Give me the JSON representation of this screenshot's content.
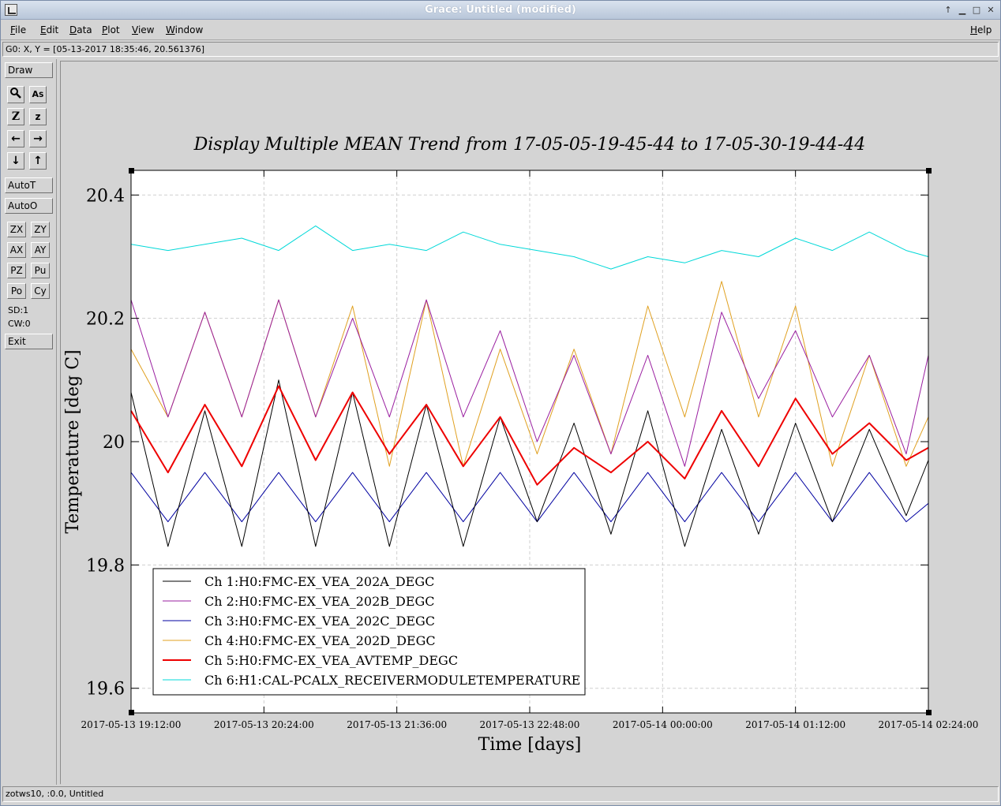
{
  "window": {
    "title": "Grace: Untitled (modified)"
  },
  "menubar": {
    "items": [
      "File",
      "Edit",
      "Data",
      "Plot",
      "View",
      "Window"
    ],
    "help": "Help"
  },
  "coord_readout": "G0: X, Y = [05-13-2017 18:35:46, 20.561376]",
  "toolbar": {
    "draw": "Draw",
    "autot": "AutoT",
    "autoo": "AutoO",
    "zx": "ZX",
    "zy": "ZY",
    "ax": "AX",
    "ay": "AY",
    "pz": "PZ",
    "pu": "Pu",
    "po": "Po",
    "cy": "Cy",
    "sd": "SD:1",
    "cw": "CW:0",
    "exit": "Exit"
  },
  "statusbar": "zotws10, :0.0, Untitled",
  "chart_data": {
    "type": "line",
    "title": "Display Multiple MEAN Trend from 17-05-05-19-45-44 to 17-05-30-19-44-44",
    "xlabel": "Time [days]",
    "ylabel": "Temperature [deg C]",
    "xlim": [
      "2017-05-13 19:12:00",
      "2017-05-14 02:24:00"
    ],
    "ylim": [
      19.56,
      20.44
    ],
    "x_ticks": [
      "2017-05-13 19:12:00",
      "2017-05-13 20:24:00",
      "2017-05-13 21:36:00",
      "2017-05-13 22:48:00",
      "2017-05-14 00:00:00",
      "2017-05-14 01:12:00",
      "2017-05-14 02:24:00"
    ],
    "y_ticks": [
      "19.6",
      "19.8",
      "20",
      "20.2",
      "20.4"
    ],
    "y_tick_values": [
      19.6,
      19.8,
      20.0,
      20.2,
      20.4
    ],
    "grid": true,
    "legend_position": "bottom-left",
    "x_minutes_from_start": [
      0,
      20,
      40,
      60,
      80,
      100,
      120,
      140,
      160,
      180,
      200,
      220,
      240,
      260,
      280,
      300,
      320,
      340,
      360,
      380,
      400,
      420,
      432
    ],
    "series": [
      {
        "name": "Ch 1:H0:FMC-EX_VEA_202A_DEGC",
        "color": "#000000",
        "width": 1,
        "values": [
          20.08,
          19.83,
          20.05,
          19.83,
          20.1,
          19.83,
          20.08,
          19.83,
          20.06,
          19.83,
          20.04,
          19.87,
          20.03,
          19.85,
          20.05,
          19.83,
          20.02,
          19.85,
          20.03,
          19.87,
          20.02,
          19.88,
          19.97
        ]
      },
      {
        "name": "Ch 2:H0:FMC-EX_VEA_202B_DEGC",
        "color": "#9a1fa0",
        "width": 1,
        "values": [
          20.23,
          20.04,
          20.21,
          20.04,
          20.23,
          20.04,
          20.2,
          20.04,
          20.23,
          20.04,
          20.18,
          20.0,
          20.14,
          19.98,
          20.14,
          19.96,
          20.21,
          20.07,
          20.18,
          20.04,
          20.14,
          19.98,
          20.14
        ]
      },
      {
        "name": "Ch 3:H0:FMC-EX_VEA_202C_DEGC",
        "color": "#0000a0",
        "width": 1,
        "values": [
          19.95,
          19.87,
          19.95,
          19.87,
          19.95,
          19.87,
          19.95,
          19.87,
          19.95,
          19.87,
          19.95,
          19.87,
          19.95,
          19.87,
          19.95,
          19.87,
          19.95,
          19.87,
          19.95,
          19.87,
          19.95,
          19.87,
          19.9
        ]
      },
      {
        "name": "Ch 4:H0:FMC-EX_VEA_202D_DEGC",
        "color": "#e0a020",
        "width": 1,
        "values": [
          20.15,
          20.04,
          20.21,
          20.04,
          20.23,
          20.04,
          20.22,
          19.96,
          20.23,
          19.96,
          20.15,
          19.98,
          20.15,
          19.98,
          20.22,
          20.04,
          20.26,
          20.04,
          20.22,
          19.96,
          20.14,
          19.96,
          20.04
        ]
      },
      {
        "name": "Ch 5:H0:FMC-EX_VEA_AVTEMP_DEGC",
        "color": "#ee0000",
        "width": 2,
        "values": [
          20.05,
          19.95,
          20.06,
          19.96,
          20.09,
          19.97,
          20.08,
          19.98,
          20.06,
          19.96,
          20.04,
          19.93,
          19.99,
          19.95,
          20.0,
          19.94,
          20.05,
          19.96,
          20.07,
          19.98,
          20.03,
          19.97,
          19.99
        ]
      },
      {
        "name": "Ch 6:H1:CAL-PCALX_RECEIVERMODULETEMPERATURE",
        "color": "#00d8d8",
        "width": 1,
        "values": [
          20.32,
          20.31,
          20.32,
          20.33,
          20.31,
          20.35,
          20.31,
          20.32,
          20.31,
          20.34,
          20.32,
          20.31,
          20.3,
          20.28,
          20.3,
          20.29,
          20.31,
          20.3,
          20.33,
          20.31,
          20.34,
          20.31,
          20.3
        ]
      }
    ]
  }
}
